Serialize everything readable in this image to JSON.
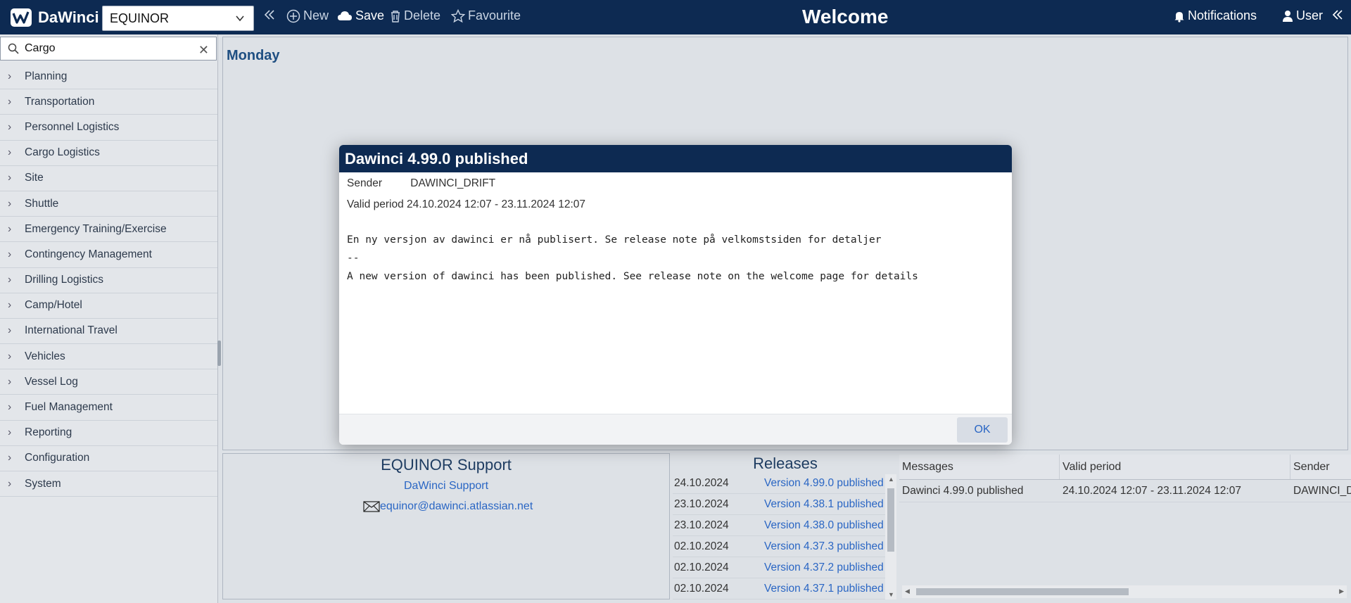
{
  "app": {
    "name": "DaWinci",
    "company": "EQUINOR",
    "page_title": "Welcome"
  },
  "toolbar": {
    "new_label": "New",
    "save_label": "Save",
    "delete_label": "Delete",
    "favourite_label": "Favourite",
    "notifications_label": "Notifications",
    "user_label": "User"
  },
  "search": {
    "value": "Cargo"
  },
  "sidebar": {
    "items": [
      {
        "label": "Planning"
      },
      {
        "label": "Transportation"
      },
      {
        "label": "Personnel Logistics"
      },
      {
        "label": "Cargo Logistics"
      },
      {
        "label": "Site"
      },
      {
        "label": "Shuttle"
      },
      {
        "label": "Emergency Training/Exercise"
      },
      {
        "label": "Contingency Management"
      },
      {
        "label": "Drilling Logistics"
      },
      {
        "label": "Camp/Hotel"
      },
      {
        "label": "International Travel"
      },
      {
        "label": "Vehicles"
      },
      {
        "label": "Vessel Log"
      },
      {
        "label": "Fuel Management"
      },
      {
        "label": "Reporting"
      },
      {
        "label": "Configuration"
      },
      {
        "label": "System"
      }
    ]
  },
  "main": {
    "day_title": "Monday"
  },
  "support": {
    "title": "EQUINOR Support",
    "link": "DaWinci Support",
    "email": "equinor@dawinci.atlassian.net"
  },
  "releases": {
    "title": "Releases",
    "rows": [
      {
        "date": "24.10.2024",
        "version": "Version 4.99.0 published"
      },
      {
        "date": "23.10.2024",
        "version": "Version 4.38.1 published"
      },
      {
        "date": "23.10.2024",
        "version": "Version 4.38.0 published"
      },
      {
        "date": "02.10.2024",
        "version": "Version 4.37.3 published"
      },
      {
        "date": "02.10.2024",
        "version": "Version 4.37.2 published"
      },
      {
        "date": "02.10.2024",
        "version": "Version 4.37.1 published"
      }
    ]
  },
  "messages": {
    "headers": {
      "messages": "Messages",
      "valid_period": "Valid period",
      "sender": "Sender"
    },
    "rows": [
      {
        "message": "Dawinci 4.99.0 published",
        "valid_period": "24.10.2024 12:07 - 23.11.2024 12:07",
        "sender": "DAWINCI_DRIFT"
      }
    ]
  },
  "modal": {
    "title": "Dawinci 4.99.0 published",
    "sender_label": "Sender",
    "sender_value": "DAWINCI_DRIFT",
    "valid_label": "Valid period",
    "valid_value": "24.10.2024 12:07 - 23.11.2024 12:07",
    "body_line1": "En ny versjon av dawinci er nå publisert. Se release note på velkomstsiden for detaljer",
    "body_line2": "--",
    "body_line3": "A new version of dawinci has been published. See release note on the welcome page for details",
    "ok_label": "OK"
  },
  "colors": {
    "header_bg": "#0d2a52",
    "link": "#2a66c4",
    "page_bg": "#dde1e6"
  }
}
